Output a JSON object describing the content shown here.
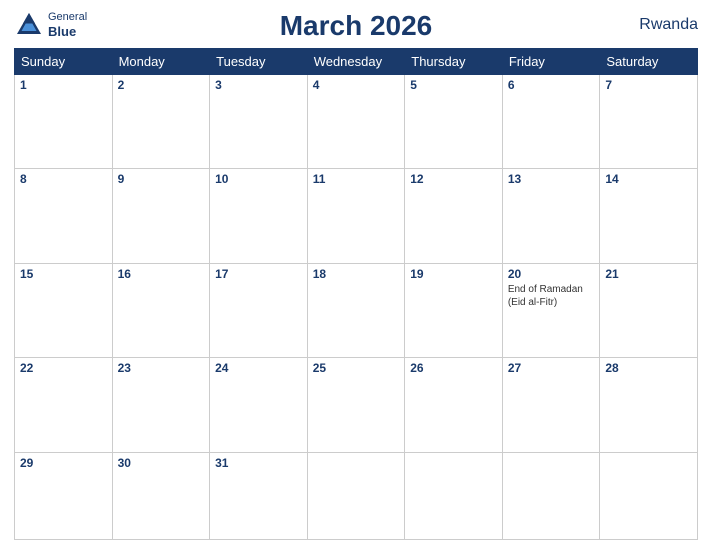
{
  "header": {
    "title": "March 2026",
    "country": "Rwanda",
    "logo": {
      "line1": "General",
      "line2": "Blue"
    }
  },
  "weekdays": [
    "Sunday",
    "Monday",
    "Tuesday",
    "Wednesday",
    "Thursday",
    "Friday",
    "Saturday"
  ],
  "weeks": [
    [
      {
        "day": 1,
        "events": []
      },
      {
        "day": 2,
        "events": []
      },
      {
        "day": 3,
        "events": []
      },
      {
        "day": 4,
        "events": []
      },
      {
        "day": 5,
        "events": []
      },
      {
        "day": 6,
        "events": []
      },
      {
        "day": 7,
        "events": []
      }
    ],
    [
      {
        "day": 8,
        "events": []
      },
      {
        "day": 9,
        "events": []
      },
      {
        "day": 10,
        "events": []
      },
      {
        "day": 11,
        "events": []
      },
      {
        "day": 12,
        "events": []
      },
      {
        "day": 13,
        "events": []
      },
      {
        "day": 14,
        "events": []
      }
    ],
    [
      {
        "day": 15,
        "events": []
      },
      {
        "day": 16,
        "events": []
      },
      {
        "day": 17,
        "events": []
      },
      {
        "day": 18,
        "events": []
      },
      {
        "day": 19,
        "events": []
      },
      {
        "day": 20,
        "events": [
          "End of Ramadan (Eid al-Fitr)"
        ]
      },
      {
        "day": 21,
        "events": []
      }
    ],
    [
      {
        "day": 22,
        "events": []
      },
      {
        "day": 23,
        "events": []
      },
      {
        "day": 24,
        "events": []
      },
      {
        "day": 25,
        "events": []
      },
      {
        "day": 26,
        "events": []
      },
      {
        "day": 27,
        "events": []
      },
      {
        "day": 28,
        "events": []
      }
    ],
    [
      {
        "day": 29,
        "events": []
      },
      {
        "day": 30,
        "events": []
      },
      {
        "day": 31,
        "events": []
      },
      {
        "day": null,
        "events": []
      },
      {
        "day": null,
        "events": []
      },
      {
        "day": null,
        "events": []
      },
      {
        "day": null,
        "events": []
      }
    ]
  ]
}
